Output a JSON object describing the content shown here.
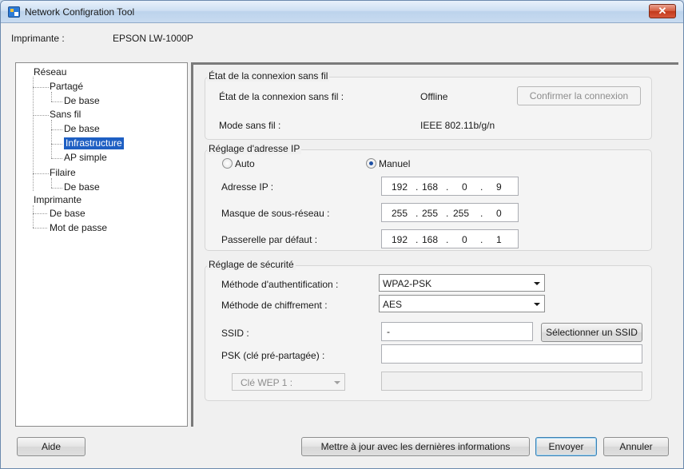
{
  "window": {
    "title": "Network Configration Tool",
    "close_glyph": "✕"
  },
  "printer": {
    "label": "Imprimante :",
    "value": "EPSON LW-1000P"
  },
  "tree": [
    {
      "label": "Réseau"
    },
    {
      "label": "Partagé"
    },
    {
      "label": "De base"
    },
    {
      "label": "Sans fil"
    },
    {
      "label": "De base"
    },
    {
      "label": "Infrastructure",
      "selected": true
    },
    {
      "label": "AP simple"
    },
    {
      "label": "Filaire"
    },
    {
      "label": "De base"
    },
    {
      "label": "Imprimante"
    },
    {
      "label": "De base"
    },
    {
      "label": "Mot de passe"
    }
  ],
  "wireless_status": {
    "title": "État de la connexion sans fil",
    "status_label": "État de la connexion sans fil :",
    "status_value": "Offline",
    "confirm_button": "Confirmer la connexion",
    "mode_label": "Mode sans fil :",
    "mode_value": "IEEE 802.11b/g/n"
  },
  "ip_settings": {
    "title": "Réglage d'adresse IP",
    "auto_label": "Auto",
    "manual_label": "Manuel",
    "selected_mode": "manual",
    "ip_label": "Adresse IP :",
    "ip": [
      "192",
      "168",
      "0",
      "9"
    ],
    "mask_label": "Masque de sous-réseau :",
    "mask": [
      "255",
      "255",
      "255",
      "0"
    ],
    "gateway_label": "Passerelle par défaut :",
    "gateway": [
      "192",
      "168",
      "0",
      "1"
    ]
  },
  "security": {
    "title": "Réglage de sécurité",
    "auth_label": "Méthode d'authentification :",
    "auth_value": "WPA2-PSK",
    "enc_label": "Méthode de chiffrement :",
    "enc_value": "AES",
    "ssid_label": "SSID :",
    "ssid_value": "-",
    "select_ssid_button": "Sélectionner un SSID",
    "psk_label": "PSK (clé pré-partagée) :",
    "psk_value": "",
    "wep_select": "Clé WEP 1 :",
    "wep_value": ""
  },
  "footer": {
    "help_button": "Aide",
    "update_button": "Mettre à jour avec les dernières informations",
    "send_button": "Envoyer",
    "cancel_button": "Annuler"
  },
  "colors": {
    "selection": "#1e5fc3",
    "radio_dot": "#1d4fa3"
  }
}
